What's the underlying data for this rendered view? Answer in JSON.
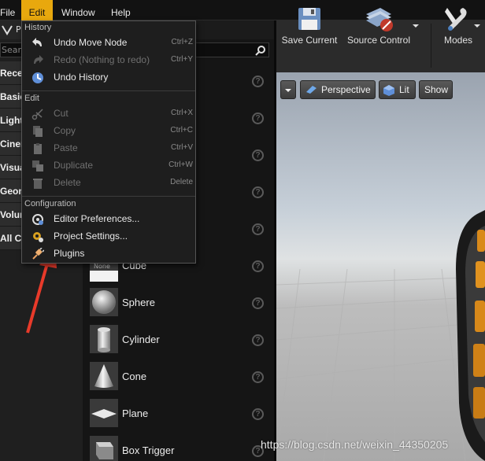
{
  "menubar": {
    "items": [
      "File",
      "Edit",
      "Window",
      "Help"
    ],
    "active": "Edit"
  },
  "tab": {
    "label": "P"
  },
  "search": {
    "placeholder": "Search"
  },
  "categories": [
    "Recent",
    "Basic",
    "Lights",
    "Cinematic",
    "Visual",
    "Geometry",
    "Volumes",
    "All Classes"
  ],
  "place_items": [
    {
      "label": "Cube",
      "thumb_text": "None"
    },
    {
      "label": "Sphere"
    },
    {
      "label": "Cylinder"
    },
    {
      "label": "Cone"
    },
    {
      "label": "Plane"
    },
    {
      "label": "Box Trigger"
    }
  ],
  "toolbar": {
    "save_label": "Save Current",
    "source_label": "Source Control",
    "modes_label": "Modes"
  },
  "viewport": {
    "perspective": "Perspective",
    "lit": "Lit",
    "show": "Show"
  },
  "edit_menu": {
    "history_title": "History",
    "undo_move": "Undo Move Node",
    "undo_move_sc": "Ctrl+Z",
    "redo": "Redo (Nothing to redo)",
    "redo_sc": "Ctrl+Y",
    "undo_history": "Undo History",
    "edit_title": "Edit",
    "cut": "Cut",
    "cut_sc": "Ctrl+X",
    "copy": "Copy",
    "copy_sc": "Ctrl+C",
    "paste": "Paste",
    "paste_sc": "Ctrl+V",
    "duplicate": "Duplicate",
    "duplicate_sc": "Ctrl+W",
    "delete": "Delete",
    "delete_sc": "Delete",
    "config_title": "Configuration",
    "editor_prefs": "Editor Preferences...",
    "project_settings": "Project Settings...",
    "plugins": "Plugins"
  },
  "watermark": "https://blog.csdn.net/weixin_44350205",
  "colors": {
    "accent": "#e8a80e",
    "arrow": "#e83a2a"
  }
}
